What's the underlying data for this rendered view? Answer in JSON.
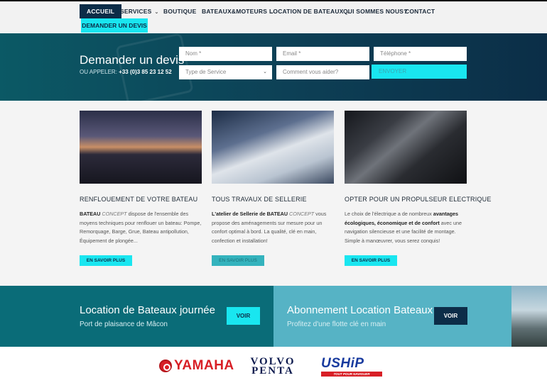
{
  "nav": {
    "items": [
      {
        "label": "ACCUEIL"
      },
      {
        "label": "SERVICES",
        "chevron": true
      },
      {
        "label": "BOUTIQUE"
      },
      {
        "label": "BATEAUX&MOTEURS",
        "chevron": true
      },
      {
        "label": "LOCATION DE BATEAUX",
        "chevron": true
      },
      {
        "label": "QUI SOMMES NOUS?"
      },
      {
        "label": "CONTACT"
      }
    ],
    "devis_button": "DEMANDER UN DEVIS"
  },
  "quote_form": {
    "title": "Demander un devis",
    "phone_prefix": "OU APPELER:",
    "phone_number": "+33 (0)3 85 23 12 52",
    "nom_placeholder": "Nom *",
    "email_placeholder": "Email *",
    "telephone_placeholder": "Téléphone *",
    "service_select": "Type de Service",
    "message_placeholder": "Comment vous aider?",
    "submit_label": "ENVOYER"
  },
  "cards": [
    {
      "title": "RENFLOUEMENT DE VOTRE BATEAU",
      "brand_bold": "BATEAU",
      "brand_italic": "CONCEPT",
      "text": " dispose de l'ensemble des moyens techniques pour renflouer un bateau: Pompe, Remorquage, Barge, Grue, Bateau antipollution, Équipement de plongée...",
      "button": "EN SAVOIR PLUS"
    },
    {
      "title": "TOUS TRAVAUX DE SELLERIE",
      "brand_bold": "L'atelier de Sellerie de BATEAU",
      "brand_italic": "CONCEPT",
      "text": " vous propose des aménagements sur mesure pour un confort optimal à bord. La qualité, clé en main, confection et installation!",
      "button": "EN SAVOIR PLUS"
    },
    {
      "title": "OPTER POUR UN PROPULSEUR ELECTRIQUE",
      "text_before": "Le choix de l'électrique a de nombreux ",
      "text_bold": "avantages écologiques, économique et de confort",
      "text_after": " avec une navigation silencieuse et une facilité de montage. Simple à manœuvrer, vous serez conquis!",
      "button": "EN SAVOIR PLUS"
    }
  ],
  "promos": {
    "left": {
      "title": "Location de Bateaux journée",
      "subtitle": "Port de plaisance de Mâcon",
      "button": "VOIR"
    },
    "right": {
      "title": "Abonnement Location Bateaux",
      "subtitle": "Profitez d'une flotte clé en main",
      "button": "VOIR"
    }
  },
  "logos": {
    "yamaha": "YAMAHA",
    "volvo_line1": "VOLVO",
    "volvo_line2": "PENTA",
    "uship": "USHiP",
    "uship_tagline": "TOUT POUR NAVIGUER"
  },
  "colors": {
    "accent": "#19e6f0",
    "navy": "#0c2d48",
    "teal": "#0a6c78",
    "light_teal": "#56b3c5",
    "yamaha_red": "#d81f26"
  }
}
